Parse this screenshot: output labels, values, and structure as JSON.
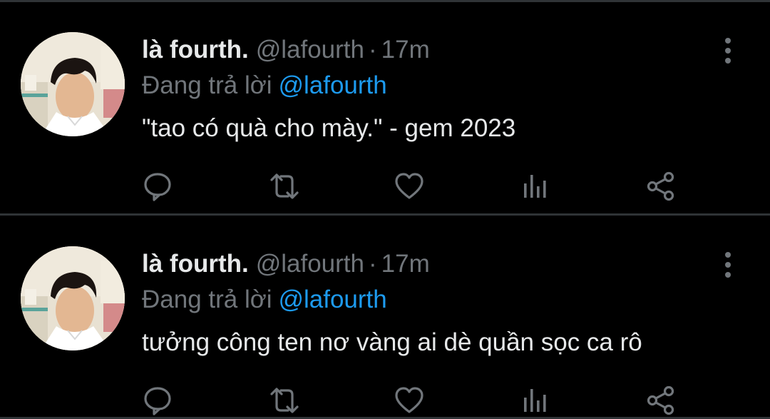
{
  "colors": {
    "background": "#000000",
    "divider": "#2f3336",
    "primary_text": "#e7e9ea",
    "secondary_text": "#71767b",
    "link": "#1d9bf0"
  },
  "tweets": [
    {
      "display_name": "là fourth.",
      "handle": "@lafourth",
      "separator": "·",
      "time": "17m",
      "reply_prefix": "Đang trả lời",
      "reply_to": "@lafourth",
      "text": "\"tao có quà cho mày.\" - gem 2023",
      "actions": [
        "reply-icon",
        "retweet-icon",
        "like-icon",
        "views-icon",
        "share-icon"
      ]
    },
    {
      "display_name": "là fourth.",
      "handle": "@lafourth",
      "separator": "·",
      "time": "17m",
      "reply_prefix": "Đang trả lời",
      "reply_to": "@lafourth",
      "text": "tưởng công ten nơ vàng ai dè quần sọc ca rô",
      "actions": [
        "reply-icon",
        "retweet-icon",
        "like-icon",
        "views-icon",
        "share-icon"
      ]
    }
  ]
}
